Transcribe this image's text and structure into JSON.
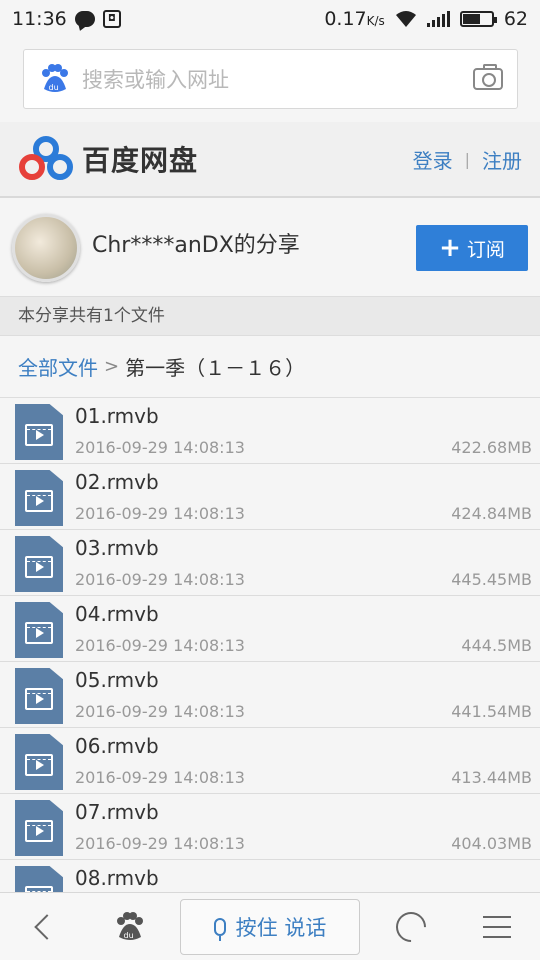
{
  "status_bar": {
    "time": "11:36",
    "speed": "0.17",
    "speed_unit": "K/s",
    "battery": "62",
    "battery_level_percent": 62
  },
  "search": {
    "placeholder": "搜索或输入网址"
  },
  "header": {
    "brand_name": "百度网盘",
    "login": "登录",
    "separator": "|",
    "register": "注册"
  },
  "share": {
    "title": "Chr****anDX的分享",
    "subscribe_label": "订阅",
    "subscribe_plus": "+",
    "file_count_text": "本分享共有1个文件"
  },
  "breadcrumb": {
    "root": "全部文件",
    "separator": ">",
    "current": "第一季（１－１６）"
  },
  "files": [
    {
      "name": "01.rmvb",
      "date": "2016-09-29 14:08:13",
      "size": "422.68MB"
    },
    {
      "name": "02.rmvb",
      "date": "2016-09-29 14:08:13",
      "size": "424.84MB"
    },
    {
      "name": "03.rmvb",
      "date": "2016-09-29 14:08:13",
      "size": "445.45MB"
    },
    {
      "name": "04.rmvb",
      "date": "2016-09-29 14:08:13",
      "size": "444.5MB"
    },
    {
      "name": "05.rmvb",
      "date": "2016-09-29 14:08:13",
      "size": "441.54MB"
    },
    {
      "name": "06.rmvb",
      "date": "2016-09-29 14:08:13",
      "size": "413.44MB"
    },
    {
      "name": "07.rmvb",
      "date": "2016-09-29 14:08:13",
      "size": "404.03MB"
    },
    {
      "name": "08.rmvb",
      "date": "",
      "size": ""
    }
  ],
  "bottom_bar": {
    "voice_label": "按住 说话"
  },
  "colors": {
    "accent_blue": "#2f7fd8",
    "link_blue": "#3d7fc2",
    "file_icon": "#5b7fa6"
  }
}
